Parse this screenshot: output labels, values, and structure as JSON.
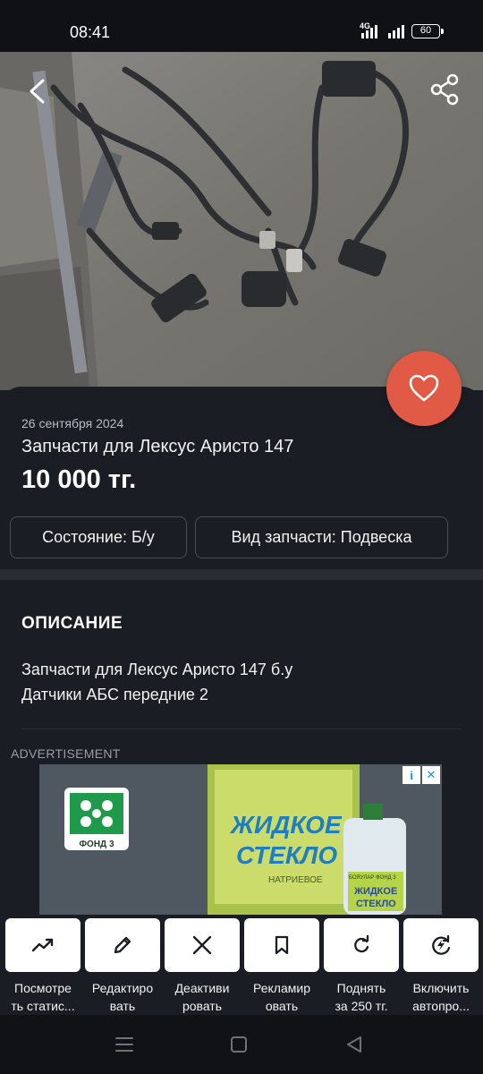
{
  "status": {
    "time": "08:41",
    "network": "4G",
    "battery": "60"
  },
  "listing": {
    "date": "26 сентября 2024",
    "title": "Запчасти для Лексус Аристо 147",
    "price": "10 000 тг.",
    "tags": [
      "Состояние: Б/у",
      "Вид запчасти: Подвеска"
    ]
  },
  "description": {
    "heading": "ОПИСАНИЕ",
    "lines": [
      "Запчасти для Лексус Аристо 147 б.у",
      "Датчики АБС передние 2"
    ]
  },
  "ad": {
    "label": "ADVERTISEMENT",
    "product_line1": "ЖИДКОЕ",
    "product_line2": "СТЕКЛО",
    "product_sub": "НАТРИЕВОЕ",
    "brand_caption": "ФОНД 3",
    "bottle_brand": "БОЯУЛАР ФОНД 3",
    "bottle_line1": "ЖИДКОЕ",
    "bottle_line2": "СТЕКЛО",
    "info_icon": "i",
    "close_icon": "✕"
  },
  "actions": [
    {
      "label": "Посмотре\nть статис...",
      "icon": "trending-up-icon"
    },
    {
      "label": "Редактиро\nвать",
      "icon": "pencil-icon"
    },
    {
      "label": "Деактиви\nровать",
      "icon": "close-icon"
    },
    {
      "label": "Рекламир\nовать",
      "icon": "bookmark-icon"
    },
    {
      "label": "Поднять\nза 250 тг.",
      "icon": "refresh-icon"
    },
    {
      "label": "Включить\nавтопро...",
      "icon": "auto-renew-icon"
    }
  ],
  "colors": {
    "background": "#1b1d24",
    "accent": "#e05a45",
    "chip_border": "#4a4d55"
  }
}
